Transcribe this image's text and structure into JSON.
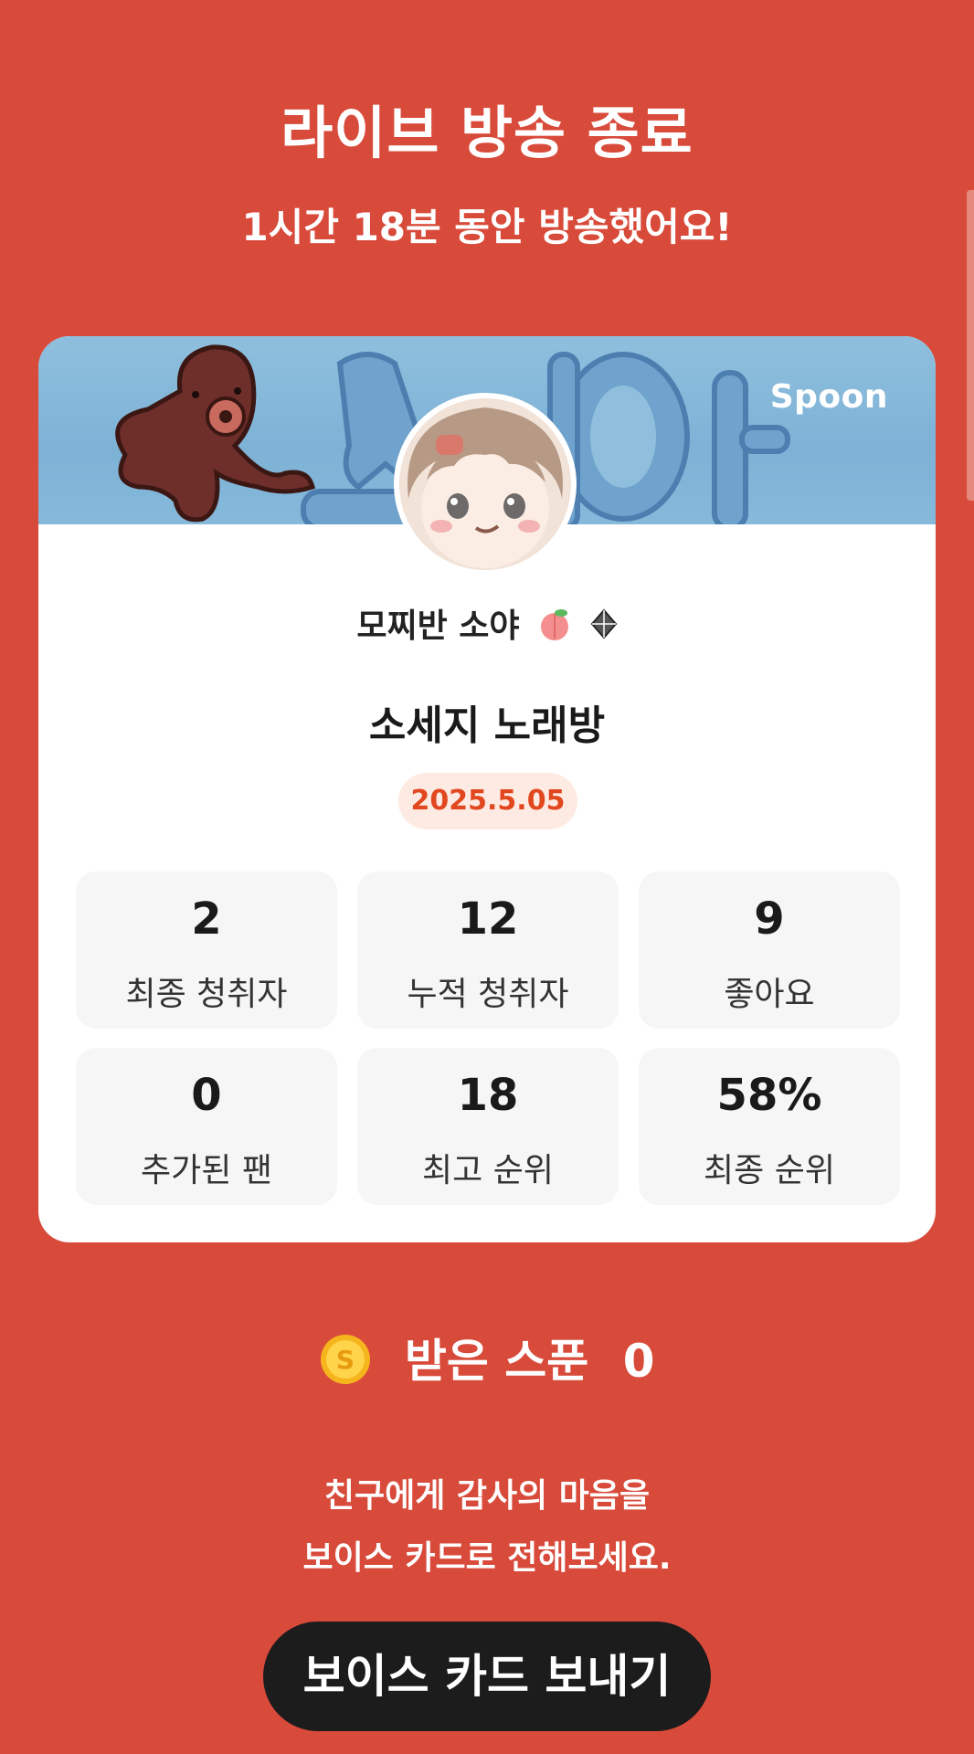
{
  "header": {
    "title": "라이브 방송 종료",
    "subtitle": "1시간 18분 동안 방송했어요!"
  },
  "card": {
    "brand": "Spoon",
    "dj_name": "모찌반 소야",
    "room_title": "소세지  노래방",
    "date": "2025.5.05",
    "stats": [
      {
        "value": "2",
        "label": "최종 청취자"
      },
      {
        "value": "12",
        "label": "누적 청취자"
      },
      {
        "value": "9",
        "label": "좋아요"
      },
      {
        "value": "0",
        "label": "추가된 팬"
      },
      {
        "value": "18",
        "label": "최고 순위"
      },
      {
        "value": "58%",
        "label": "최종 순위"
      }
    ]
  },
  "spoons": {
    "label": "받은 스푼",
    "value": "0"
  },
  "message": {
    "line1": "친구에게 감사의 마음을",
    "line2": "보이스 카드로 전해보세요."
  },
  "cta": {
    "label": "보이스 카드 보내기"
  },
  "colors": {
    "background": "#D84A3A",
    "accent": "#E2481F",
    "button": "#1C1C1C"
  }
}
